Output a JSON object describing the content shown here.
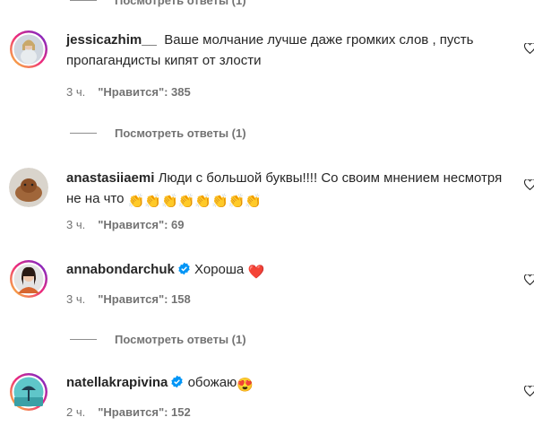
{
  "view_replies": "Посмотреть ответы (1)",
  "comments": [
    {
      "username": "jessicazhim__",
      "text": "Ваше молчание лучше даже громких слов , пусть пропагандисты кипят от злости",
      "time": "3 ч.",
      "likes": "\"Нравится\": 385"
    },
    {
      "username": "anastasiiaemi",
      "text": "Люди с большой буквы!!!! Со своим мнением несмотря не на что",
      "emoji": "👏👏👏👏👏👏👏👏",
      "time": "3 ч.",
      "likes": "\"Нравится\": 69"
    },
    {
      "username": "annabondarchuk",
      "text": "Хороша",
      "emoji": "❤️",
      "time": "3 ч.",
      "likes": "\"Нравится\": 158"
    },
    {
      "username": "natellakrapivina",
      "text": "обожаю",
      "emoji": "😍",
      "time": "2 ч.",
      "likes": "\"Нравится\": 152"
    }
  ],
  "colors": {
    "verified": "#0095f6",
    "story_ring": "#d62976",
    "muted": "#737373"
  }
}
